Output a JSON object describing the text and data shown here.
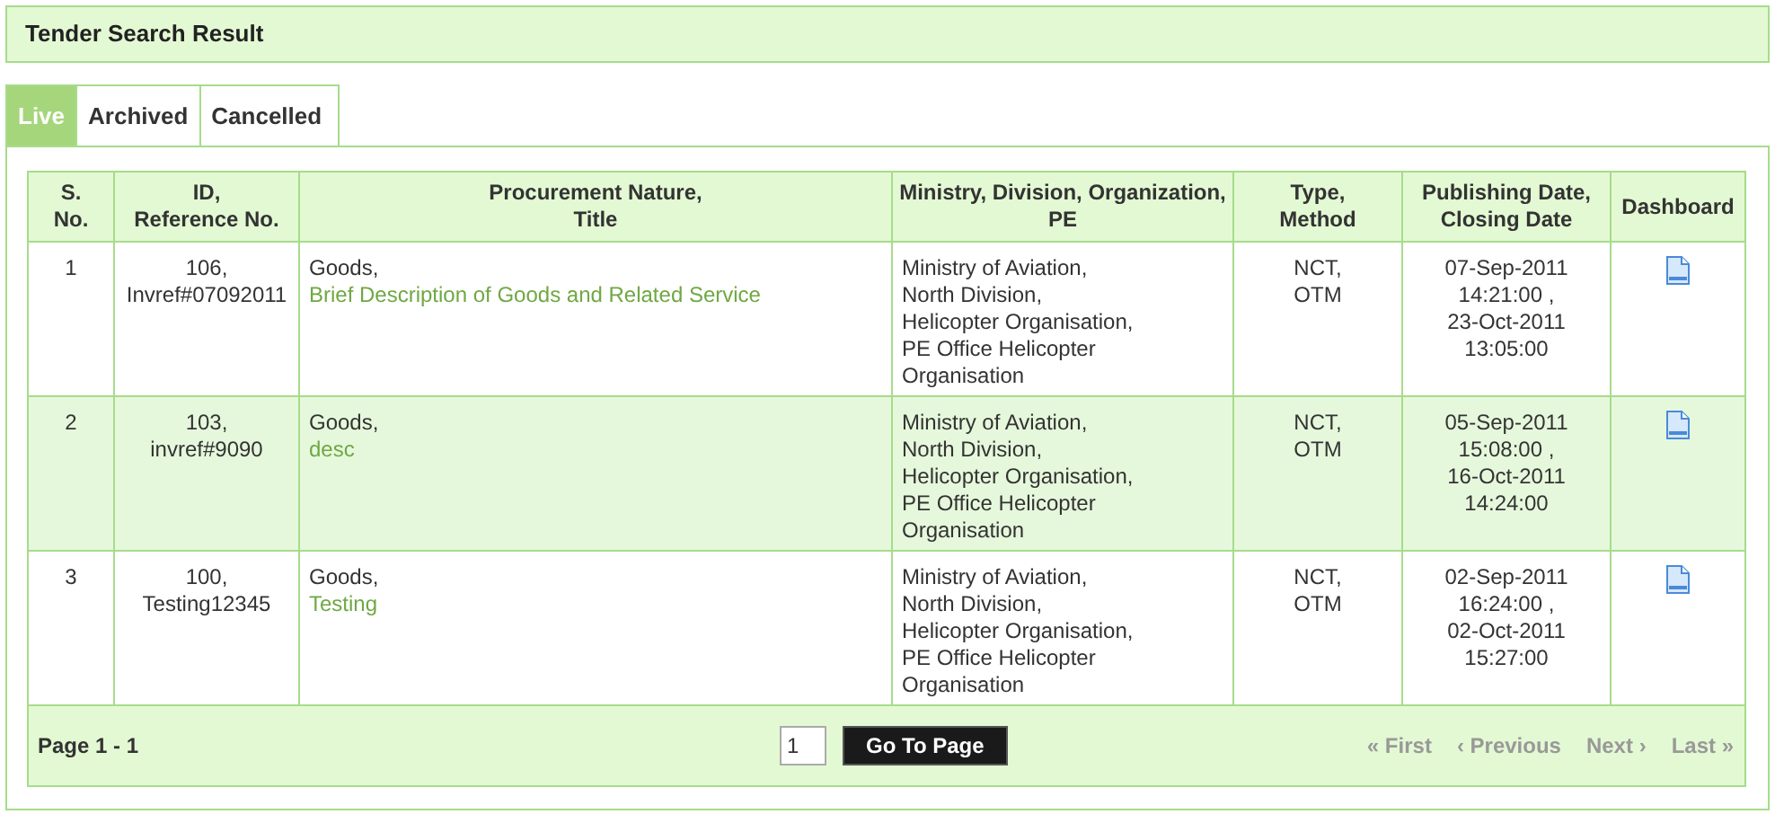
{
  "header": {
    "title": "Tender Search Result"
  },
  "tabs": [
    {
      "label": "Live",
      "selected": true
    },
    {
      "label": "Archived",
      "selected": false
    },
    {
      "label": "Cancelled",
      "selected": false
    }
  ],
  "table": {
    "columns": [
      "S.\nNo.",
      "ID,\nReference No.",
      "Procurement Nature,\nTitle",
      "Ministry, Division, Organization,\nPE",
      "Type,\nMethod",
      "Publishing Date,\nClosing Date",
      "Dashboard"
    ],
    "rows": [
      {
        "no": "1",
        "id": "106,\nInvref#07092011",
        "nature": "Goods,",
        "title": "Brief Description of Goods and Related Service",
        "ministry": "Ministry of Aviation,\nNorth Division,\nHelicopter Organisation,\nPE Office Helicopter\nOrganisation",
        "type": "NCT,\nOTM",
        "dates": "07-Sep-2011\n14:21:00 ,\n23-Oct-2011\n13:05:00"
      },
      {
        "no": "2",
        "id": "103,\ninvref#9090",
        "nature": "Goods,",
        "title": "desc",
        "ministry": "Ministry of Aviation,\nNorth Division,\nHelicopter Organisation,\nPE Office Helicopter\nOrganisation",
        "type": "NCT,\nOTM",
        "dates": "05-Sep-2011\n15:08:00 ,\n16-Oct-2011\n14:24:00"
      },
      {
        "no": "3",
        "id": "100,\nTesting12345",
        "nature": "Goods,",
        "title": "Testing",
        "ministry": "Ministry of Aviation,\nNorth Division,\nHelicopter Organisation,\nPE Office Helicopter\nOrganisation",
        "type": "NCT,\nOTM",
        "dates": "02-Sep-2011\n16:24:00 ,\n02-Oct-2011\n15:27:00"
      }
    ]
  },
  "pager": {
    "label": "Page 1 - 1",
    "page_value": "1",
    "go_button": "Go To Page",
    "links": [
      {
        "label": "« First",
        "disabled": true
      },
      {
        "label": "‹ Previous",
        "disabled": true
      },
      {
        "label": "Next ›",
        "disabled": true
      },
      {
        "label": "Last »",
        "disabled": true
      }
    ]
  }
}
